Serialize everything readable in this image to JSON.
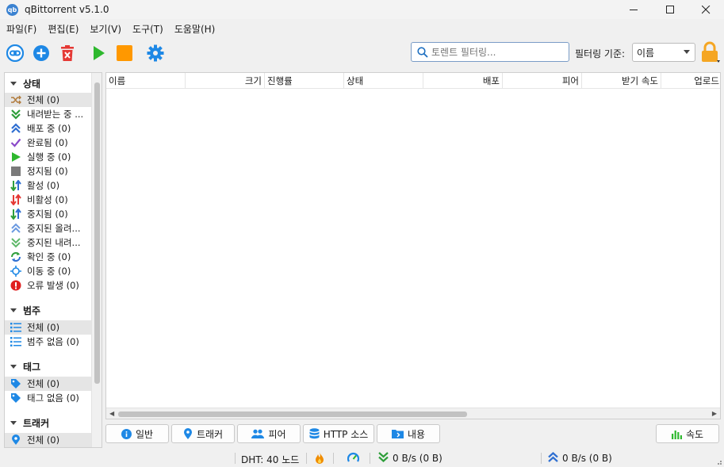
{
  "window": {
    "title": "qBittorrent v5.1.0",
    "app_icon_text": "qb",
    "minimize": "—",
    "maximize": "☐",
    "close": "✕"
  },
  "menu": [
    "파일(F)",
    "편집(E)",
    "보기(V)",
    "도구(T)",
    "도움말(H)"
  ],
  "toolbar": {
    "search_placeholder": "토렌트 필터링...",
    "filter_label": "필터링 기준:",
    "filter_value": "이름",
    "icons": [
      "link-icon",
      "add-icon",
      "delete-icon",
      "play-icon",
      "stop-icon",
      "settings-icon",
      "lock-icon"
    ],
    "colors": {
      "blue": "#1e88e5",
      "red": "#e53935",
      "green": "#2eb82e",
      "orange": "#ff9800"
    }
  },
  "sidebar": {
    "status_header": "상태",
    "status_items": [
      "전체 (0)",
      "내려받는 중 ...",
      "배포 중 (0)",
      "완료됨 (0)",
      "실행 중 (0)",
      "정지됨 (0)",
      "활성 (0)",
      "비활성 (0)",
      "중지됨 (0)",
      "중지된 올려...",
      "중지된 내려...",
      "확인 중 (0)",
      "이동 중 (0)",
      "오류 발생 (0)"
    ],
    "category_header": "범주",
    "category_items": [
      "전체 (0)",
      "범주 없음 (0)"
    ],
    "tag_header": "태그",
    "tag_items": [
      "전체 (0)",
      "태그 없음 (0)"
    ],
    "tracker_header": "트래커",
    "tracker_items": [
      "전체 (0)"
    ]
  },
  "table": {
    "columns": [
      "이름",
      "크기",
      "진행률",
      "상태",
      "배포",
      "피어",
      "받기 속도",
      "업로드"
    ]
  },
  "tabs": [
    "일반",
    "트래커",
    "피어",
    "HTTP 소스",
    "내용"
  ],
  "speed_tab": "속도",
  "status": {
    "dht": "DHT: 40 노드",
    "down": "0 B/s (0 B)",
    "up": "0 B/s (0 B)"
  }
}
